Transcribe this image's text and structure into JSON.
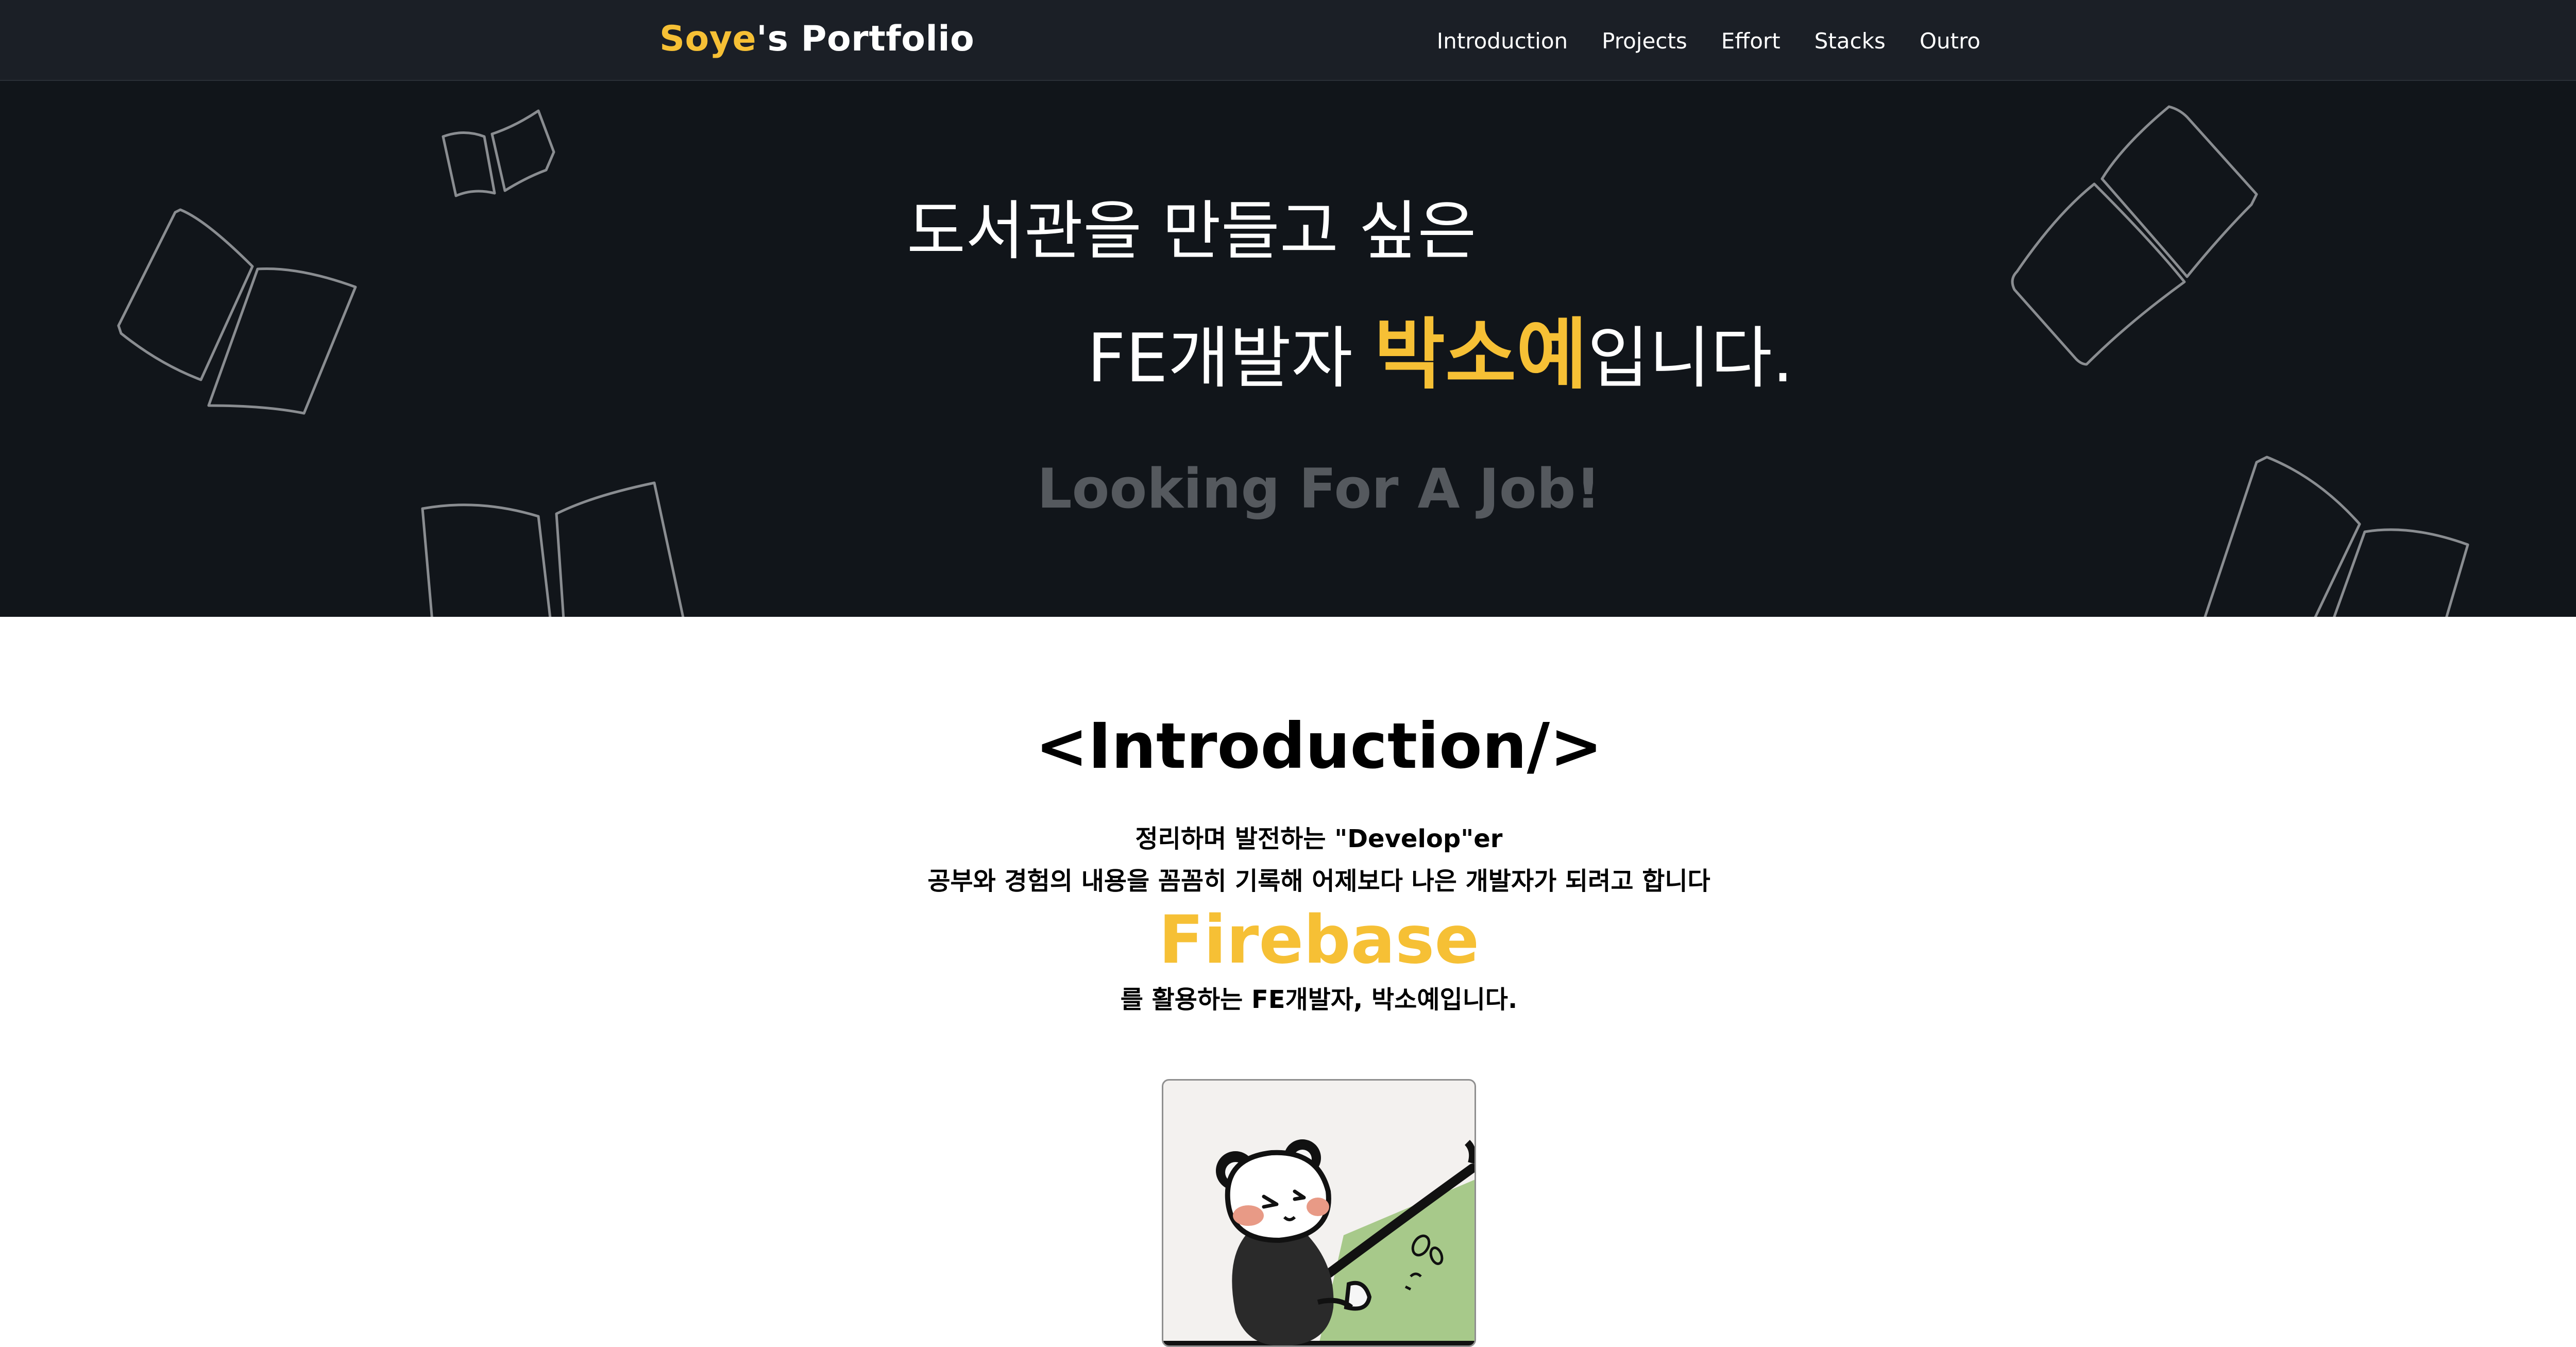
{
  "nav": {
    "logo_accent": "Soye",
    "logo_rest": "'s Portfolio",
    "items": [
      "Introduction",
      "Projects",
      "Effort",
      "Stacks",
      "Outro"
    ]
  },
  "hero": {
    "line1": "도서관을 만들고 싶은",
    "line2_prefix": "FE개발자 ",
    "line2_name": "박소예",
    "line2_suffix": "입니다.",
    "job_text": "Looking For A Job!"
  },
  "intro": {
    "title": "<Introduction/>",
    "line1": "정리하며 발전하는 \"Develop\"er",
    "line2": "공부와 경험의 내용을 꼼꼼히 기록해 어제보다 나은 개발자가 되려고 합니다",
    "keyword": "Firebase",
    "line3": "를 활용하는 FE개발자, 박소예입니다."
  },
  "colors": {
    "accent": "#f6c035",
    "nav_bg": "#1b1f26",
    "hero_bg": "#11151a",
    "muted_text": "#55595e"
  }
}
